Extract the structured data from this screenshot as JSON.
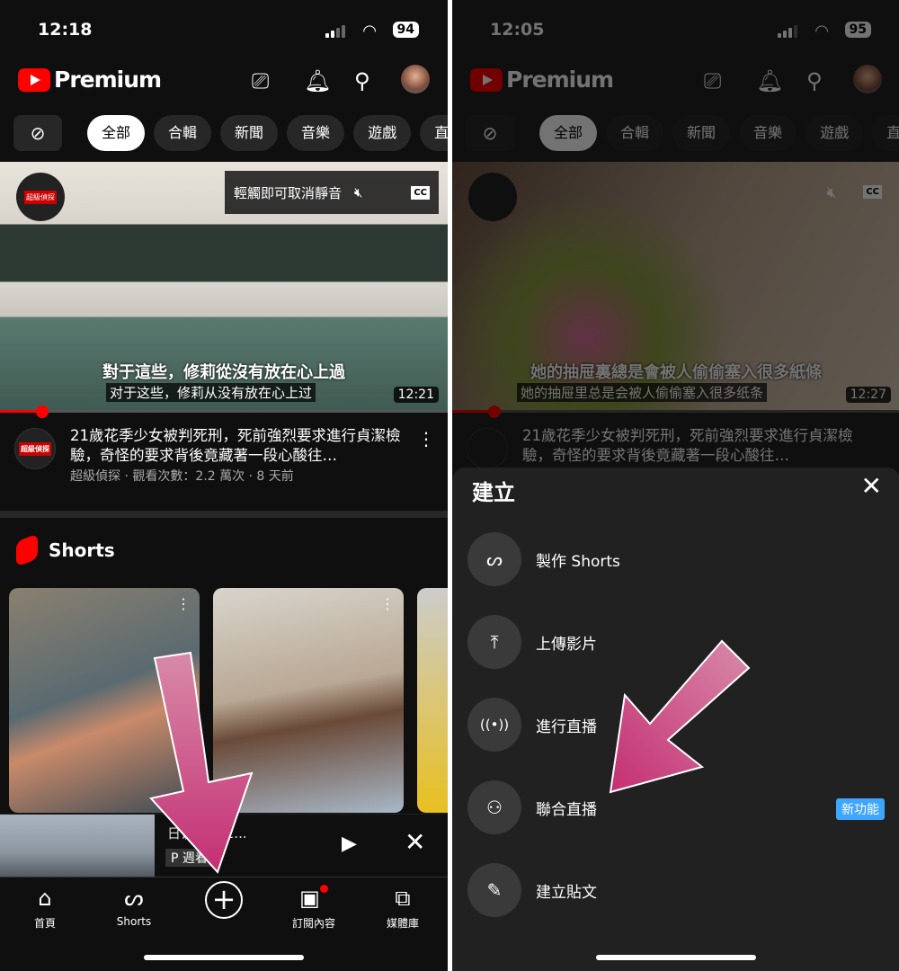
{
  "left": {
    "status": {
      "time": "12:18",
      "battery": "94"
    },
    "header": {
      "brand": "Premium"
    },
    "chips": [
      "全部",
      "合輯",
      "新聞",
      "音樂",
      "遊戲",
      "直播"
    ],
    "video": {
      "overlay_text": "輕觸即可取消靜音",
      "cc": "CC",
      "subtitle_trad": "對于這些，修莉從沒有放在心上過",
      "subtitle_simp": "对于这些，修莉从没有放在心上过",
      "duration": "12:21",
      "channel_logo": "超級偵探",
      "title": "21歲花季少女被判死刑，死前強烈要求進行貞潔檢驗，奇怪的要求背後竟藏著一段心酸往…",
      "meta": "超級偵探 · 觀看次數：2.2 萬次 · 8 天前"
    },
    "shorts": {
      "heading": "Shorts"
    },
    "mini_player": {
      "title": "日说法》 2...",
      "channel": "P 週看"
    },
    "nav": [
      {
        "label": "首頁",
        "icon": "home-icon"
      },
      {
        "label": "Shorts",
        "icon": "shorts-icon"
      },
      {
        "label": "",
        "icon": "create-plus-icon"
      },
      {
        "label": "訂閱內容",
        "icon": "subscriptions-icon"
      },
      {
        "label": "媒體庫",
        "icon": "library-icon"
      }
    ]
  },
  "right": {
    "status": {
      "time": "12:05",
      "battery": "95"
    },
    "header": {
      "brand": "Premium"
    },
    "chips": [
      "全部",
      "合輯",
      "新聞",
      "音樂",
      "遊戲",
      "直"
    ],
    "video": {
      "subtitle_trad": "她的抽屉裏總是會被人偷偷塞入很多紙條",
      "subtitle_simp": "她的抽屉里总是会被人偷偷塞入很多纸条",
      "duration": "12:27",
      "title": "21歲花季少女被判死刑，死前強烈要求進行貞潔檢驗，奇怪的要求背後竟藏著一段心酸往…"
    },
    "sheet": {
      "title": "建立",
      "items": [
        {
          "label": "製作 Shorts",
          "icon": "shorts-icon"
        },
        {
          "label": "上傳影片",
          "icon": "upload-icon"
        },
        {
          "label": "進行直播",
          "icon": "live-icon"
        },
        {
          "label": "聯合直播",
          "icon": "collab-live-icon",
          "badge": "新功能"
        },
        {
          "label": "建立貼文",
          "icon": "post-icon"
        }
      ]
    }
  },
  "colors": {
    "brand_red": "#ff0000",
    "arrow_pink": "#c93a7c",
    "badge_blue": "#3ea6ff",
    "sheet_bg": "#212121"
  }
}
